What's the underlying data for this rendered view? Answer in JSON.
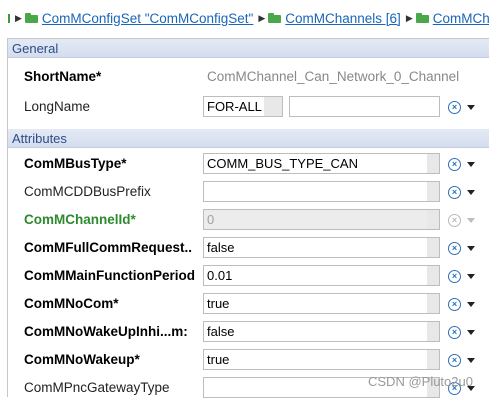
{
  "breadcrumb": {
    "items": [
      {
        "label": "ComMConfigSet \"ComMConfigSet\""
      },
      {
        "label": "ComMChannels [6]"
      },
      {
        "label": "ComMCh"
      }
    ]
  },
  "general": {
    "header": "General",
    "short_name": {
      "label": "ShortName*",
      "value": "ComMChannel_Can_Network_0_Channel"
    },
    "long_name": {
      "label": "LongName",
      "lang": "FOR-ALL",
      "value": ""
    }
  },
  "attributes": {
    "header": "Attributes",
    "rows": [
      {
        "label": "ComMBusType*",
        "value": "COMM_BUS_TYPE_CAN",
        "style": "bold"
      },
      {
        "label": "ComMCDDBusPrefix",
        "value": "",
        "style": "normal"
      },
      {
        "label": "ComMChannelId*",
        "value": "0",
        "style": "green",
        "disabled": true
      },
      {
        "label": "ComMFullCommRequest..",
        "value": "false",
        "style": "bold"
      },
      {
        "label": "ComMMainFunctionPeriod",
        "value": "0.01",
        "style": "bold"
      },
      {
        "label": "ComMNoCom*",
        "value": "true",
        "style": "bold"
      },
      {
        "label": "ComMNoWakeUpInhi...m:",
        "value": "false",
        "style": "bold"
      },
      {
        "label": "ComMNoWakeup*",
        "value": "true",
        "style": "bold"
      },
      {
        "label": "ComMPncGatewayType",
        "value": "",
        "style": "normal"
      }
    ]
  },
  "watermark": "CSDN @Pluto2u0",
  "colors": {
    "link": "#1a66b8",
    "section_text": "#2c4d86",
    "green_label": "#2f8a2f",
    "action_icon": "#2d6fb8"
  },
  "icons": {
    "reset": "circle-x-icon",
    "menu": "triangle-down-icon",
    "folder": "folder-icon"
  }
}
